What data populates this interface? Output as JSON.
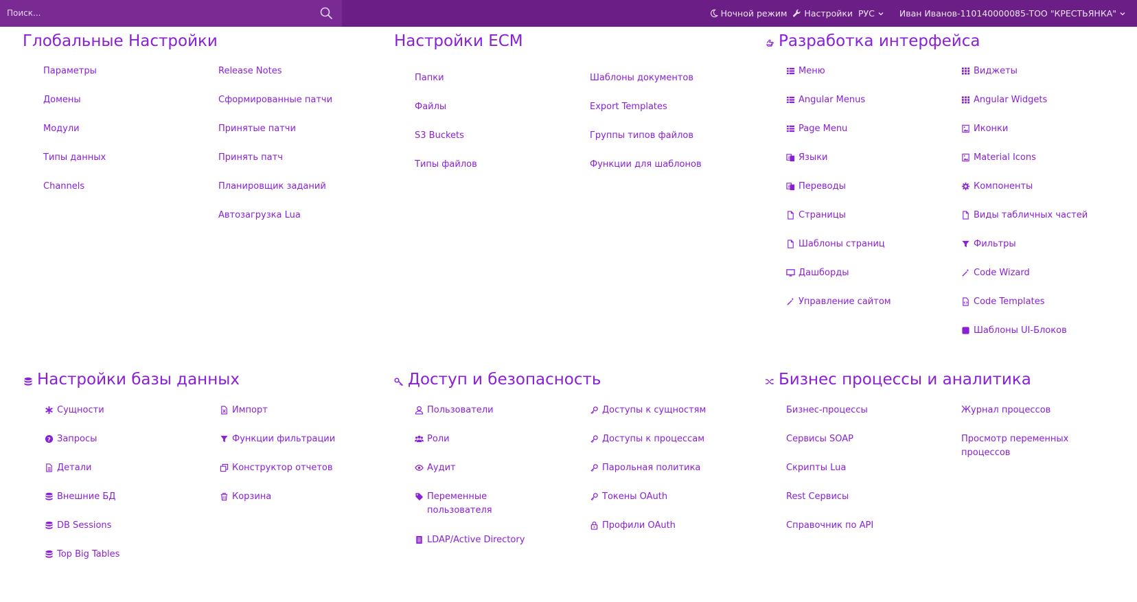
{
  "topbar": {
    "search_placeholder": "Поиск...",
    "night_mode": "Ночной режим",
    "settings": "Настройки",
    "language": "РУС",
    "user": "Иван Иванов-110140000085-ТОО \"КРЕСТЬЯНКА\""
  },
  "sections": {
    "global": {
      "title": "Глобальные Настройки",
      "col1": [
        "Параметры",
        "Домены",
        "Модули",
        "Типы данных",
        "Channels"
      ],
      "col2": [
        "Release Notes",
        "Сформированные патчи",
        "Принятые патчи",
        "Принять патч",
        "Планировщик заданий",
        "Автозагрузка Lua"
      ]
    },
    "ecm": {
      "title": "Настройки ECM",
      "col1": [
        "Папки",
        "Файлы",
        "S3 Buckets",
        "Типы файлов"
      ],
      "col2": [
        "Шаблоны документов",
        "Export Templates",
        "Группы типов файлов",
        "Функции для шаблонов"
      ]
    },
    "ui_dev": {
      "title": "Разработка интерфейса",
      "col1": [
        {
          "label": "Меню",
          "icon": "list-icon"
        },
        {
          "label": "Angular Menus",
          "icon": "list-icon"
        },
        {
          "label": "Page Menu",
          "icon": "list-icon"
        },
        {
          "label": "Языки",
          "icon": "language-icon"
        },
        {
          "label": "Переводы",
          "icon": "language-icon"
        },
        {
          "label": "Страницы",
          "icon": "file-icon"
        },
        {
          "label": "Шаблоны страниц",
          "icon": "file-icon"
        },
        {
          "label": "Дашборды",
          "icon": "monitor-icon"
        },
        {
          "label": "Управление сайтом",
          "icon": "wand-icon"
        }
      ],
      "col2": [
        {
          "label": "Виджеты",
          "icon": "grid-icon"
        },
        {
          "label": "Angular Widgets",
          "icon": "grid-icon"
        },
        {
          "label": "Иконки",
          "icon": "image-icon"
        },
        {
          "label": "Material Icons",
          "icon": "image-icon"
        },
        {
          "label": "Компоненты",
          "icon": "cogs-icon"
        },
        {
          "label": "Виды табличных частей",
          "icon": "file-icon"
        },
        {
          "label": "Фильтры",
          "icon": "filter-icon"
        },
        {
          "label": "Code Wizard",
          "icon": "wand-icon"
        },
        {
          "label": "Code Templates",
          "icon": "file-code-icon"
        },
        {
          "label": "Шаблоны UI-Блоков",
          "icon": "square-icon"
        }
      ]
    },
    "database": {
      "title": "Настройки базы данных",
      "col1": [
        {
          "label": "Сущности",
          "icon": "asterisk-icon"
        },
        {
          "label": "Запросы",
          "icon": "question-icon"
        },
        {
          "label": "Детали",
          "icon": "document-icon"
        },
        {
          "label": "Внешние БД",
          "icon": "database-icon"
        },
        {
          "label": "DB Sessions",
          "icon": "database-icon"
        },
        {
          "label": "Top Big Tables",
          "icon": "database-icon"
        }
      ],
      "col2": [
        {
          "label": "Импорт",
          "icon": "file-excel-icon"
        },
        {
          "label": "Функции фильтрации",
          "icon": "filter-icon"
        },
        {
          "label": "Конструктор отчетов",
          "icon": "clone-icon"
        },
        {
          "label": "Корзина",
          "icon": "trash-icon"
        }
      ]
    },
    "access": {
      "title": "Доступ и безопасность",
      "col1": [
        {
          "label": "Пользователи",
          "icon": "user-icon"
        },
        {
          "label": "Роли",
          "icon": "users-icon"
        },
        {
          "label": "Аудит",
          "icon": "eye-icon"
        },
        {
          "label": "Переменные пользователя",
          "icon": "tag-icon"
        },
        {
          "label": "LDAP/Active Directory",
          "icon": "book-icon"
        }
      ],
      "col2": [
        {
          "label": "Доступы к сущностям",
          "icon": "key-icon"
        },
        {
          "label": "Доступы к процессам",
          "icon": "key-icon"
        },
        {
          "label": "Парольная политика",
          "icon": "key-icon"
        },
        {
          "label": "Токены OAuth",
          "icon": "key-icon"
        },
        {
          "label": "Профили OAuth",
          "icon": "lock-icon"
        }
      ]
    },
    "bp": {
      "title": "Бизнес процессы и аналитика",
      "col1": [
        "Бизнес-процессы",
        "Сервисы SOAP",
        "Скрипты Lua",
        "Rest Сервисы",
        "Справочник по API"
      ],
      "col2": [
        "Журнал процессов",
        "Просмотр переменных процессов"
      ]
    }
  },
  "colors": {
    "accent": "#8a1fd8",
    "topbar": "#6a1e86",
    "search_bg": "#7a2a93"
  }
}
